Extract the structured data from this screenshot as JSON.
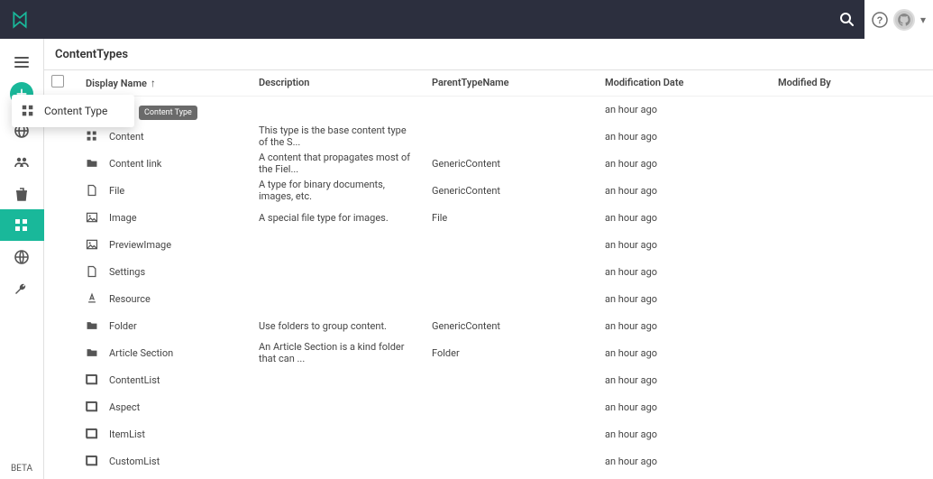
{
  "topbar": {
    "search_icon": "search-icon",
    "help_icon": "help-icon",
    "avatar_icon": "avatar",
    "chevron": "chevron-down-icon"
  },
  "sidebar": {
    "items": [
      {
        "name": "hamburger-icon"
      },
      {
        "name": "add-button",
        "label": "+"
      },
      {
        "name": "globe-icon"
      },
      {
        "name": "people-icon"
      },
      {
        "name": "trash-icon"
      },
      {
        "name": "widgets-icon",
        "active": true
      },
      {
        "name": "language-icon"
      },
      {
        "name": "wrench-icon"
      }
    ],
    "beta_label": "BETA"
  },
  "page": {
    "title": "ContentTypes"
  },
  "popover": {
    "label": "Content Type"
  },
  "tooltip": {
    "text": "Content Type"
  },
  "columns": {
    "display_name": "Display Name",
    "description": "Description",
    "parent": "ParentTypeName",
    "mod_date": "Modification Date",
    "mod_by": "Modified By"
  },
  "rows": [
    {
      "name": "",
      "icon": "",
      "desc": "",
      "parent": "",
      "mod": "an hour ago",
      "by": ""
    },
    {
      "name": "Content",
      "icon": "widgets",
      "desc": "This type is the base content type of the S...",
      "parent": "",
      "mod": "an hour ago",
      "by": ""
    },
    {
      "name": "Content link",
      "icon": "folder",
      "desc": "A content that propagates most of the Fiel...",
      "parent": "GenericContent",
      "mod": "an hour ago",
      "by": ""
    },
    {
      "name": "File",
      "icon": "file",
      "desc": "A type for binary documents, images, etc.",
      "parent": "GenericContent",
      "mod": "an hour ago",
      "by": ""
    },
    {
      "name": "Image",
      "icon": "image",
      "desc": "A special file type for images.",
      "parent": "File",
      "mod": "an hour ago",
      "by": ""
    },
    {
      "name": "PreviewImage",
      "icon": "image",
      "desc": "",
      "parent": "",
      "mod": "an hour ago",
      "by": ""
    },
    {
      "name": "Settings",
      "icon": "file",
      "desc": "",
      "parent": "",
      "mod": "an hour ago",
      "by": ""
    },
    {
      "name": "Resource",
      "icon": "textformat",
      "desc": "",
      "parent": "",
      "mod": "an hour ago",
      "by": ""
    },
    {
      "name": "Folder",
      "icon": "folder",
      "desc": "Use folders to group content.",
      "parent": "GenericContent",
      "mod": "an hour ago",
      "by": ""
    },
    {
      "name": "Article Section",
      "icon": "folder",
      "desc": "An Article Section is a kind folder that can ...",
      "parent": "Folder",
      "mod": "an hour ago",
      "by": ""
    },
    {
      "name": "ContentList",
      "icon": "list",
      "desc": "",
      "parent": "",
      "mod": "an hour ago",
      "by": ""
    },
    {
      "name": "Aspect",
      "icon": "list",
      "desc": "",
      "parent": "",
      "mod": "an hour ago",
      "by": ""
    },
    {
      "name": "ItemList",
      "icon": "list",
      "desc": "",
      "parent": "",
      "mod": "an hour ago",
      "by": ""
    },
    {
      "name": "CustomList",
      "icon": "list",
      "desc": "",
      "parent": "",
      "mod": "an hour ago",
      "by": ""
    }
  ]
}
